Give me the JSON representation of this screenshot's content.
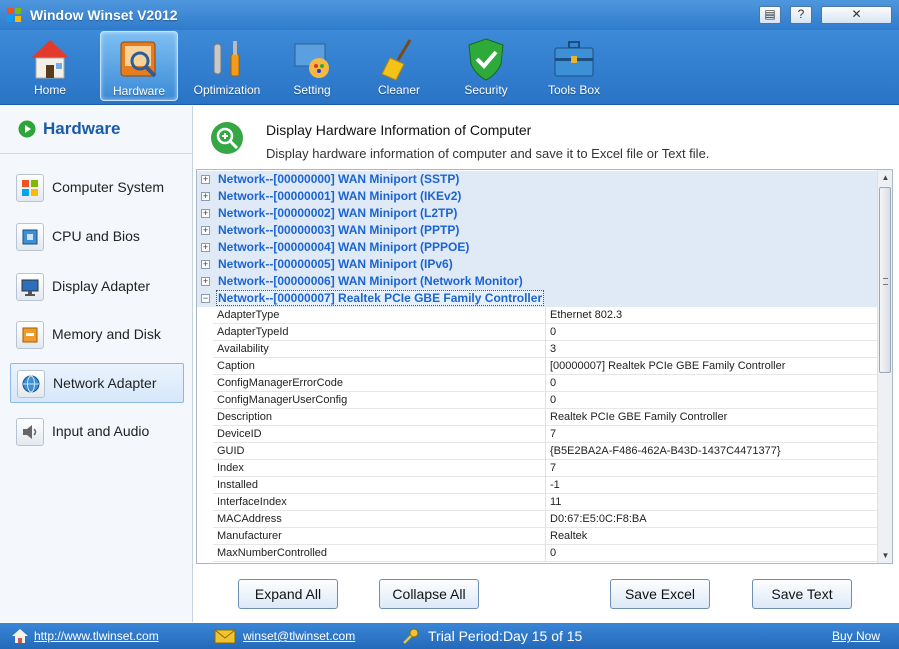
{
  "window": {
    "title": "Window Winset V2012",
    "controls": [
      "menu-icon",
      "help-icon",
      "close-icon"
    ]
  },
  "toolbar": {
    "items": [
      {
        "label": "Home",
        "icon": "home-icon"
      },
      {
        "label": "Hardware",
        "icon": "hardware-icon",
        "active": true
      },
      {
        "label": "Optimization",
        "icon": "optimization-icon"
      },
      {
        "label": "Setting",
        "icon": "setting-icon"
      },
      {
        "label": "Cleaner",
        "icon": "broom-icon"
      },
      {
        "label": "Security",
        "icon": "shield-icon"
      },
      {
        "label": "Tools Box",
        "icon": "toolbox-icon"
      }
    ]
  },
  "sidebar": {
    "title": "Hardware",
    "items": [
      {
        "label": "Computer System",
        "icon": "windows-icon"
      },
      {
        "label": "CPU and Bios",
        "icon": "cpu-icon"
      },
      {
        "label": "Display Adapter",
        "icon": "monitor-icon"
      },
      {
        "label": "Memory and Disk",
        "icon": "memory-icon"
      },
      {
        "label": "Network Adapter",
        "icon": "globe-icon",
        "active": true
      },
      {
        "label": "Input and Audio",
        "icon": "speaker-icon"
      }
    ]
  },
  "header": {
    "title": "Display  Hardware Information of Computer",
    "subtitle": "Display hardware information of computer and save it to Excel file or Text file."
  },
  "tree": {
    "groups": [
      "Network--[00000000] WAN Miniport (SSTP)",
      "Network--[00000001] WAN Miniport (IKEv2)",
      "Network--[00000002] WAN Miniport (L2TP)",
      "Network--[00000003] WAN Miniport (PPTP)",
      "Network--[00000004] WAN Miniport (PPPOE)",
      "Network--[00000005] WAN Miniport (IPv6)",
      "Network--[00000006] WAN Miniport (Network Monitor)",
      "Network--[00000007] Realtek PCIe GBE Family Controller"
    ],
    "expanded_rows": [
      {
        "key": "AdapterType",
        "value": "Ethernet 802.3"
      },
      {
        "key": "AdapterTypeId",
        "value": "0"
      },
      {
        "key": "Availability",
        "value": "3"
      },
      {
        "key": "Caption",
        "value": "[00000007] Realtek PCIe GBE Family Controller"
      },
      {
        "key": "ConfigManagerErrorCode",
        "value": "0"
      },
      {
        "key": "ConfigManagerUserConfig",
        "value": "0"
      },
      {
        "key": "Description",
        "value": "Realtek PCIe GBE Family Controller"
      },
      {
        "key": "DeviceID",
        "value": "7"
      },
      {
        "key": "GUID",
        "value": "{B5E2BA2A-F486-462A-B43D-1437C4471377}"
      },
      {
        "key": "Index",
        "value": "7"
      },
      {
        "key": "Installed",
        "value": "-1"
      },
      {
        "key": "InterfaceIndex",
        "value": "11"
      },
      {
        "key": "MACAddress",
        "value": "D0:67:E5:0C:F8:BA"
      },
      {
        "key": "Manufacturer",
        "value": "Realtek"
      },
      {
        "key": "MaxNumberControlled",
        "value": "0"
      }
    ]
  },
  "buttons": {
    "expand_all": "Expand All",
    "collapse_all": "Collapse All",
    "save_excel": "Save Excel",
    "save_text": "Save Text"
  },
  "status": {
    "website": "http://www.tlwinset.com",
    "email": "winset@tlwinset.com",
    "trial": "Trial Period:Day 15 of 15",
    "buy": "Buy Now"
  },
  "colors": {
    "accent": "#2f7bcc",
    "group_text": "#1b64d2",
    "sidebar_title": "#1b5ca8"
  }
}
